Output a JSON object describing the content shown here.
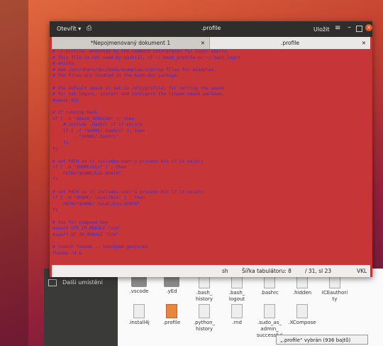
{
  "editor": {
    "open_label": "Otevřít",
    "title": ".profile",
    "save_label": "Uložit",
    "tabs": [
      {
        "label": "*Nepojmenovaný dokument 1"
      },
      {
        "label": ".profile"
      }
    ],
    "status": {
      "language": "sh",
      "tab_width": "Šířka tabulátoru: 8",
      "position": "/ 31, sl 23",
      "mode": "VKL"
    }
  },
  "code_lines": [
    "# ~/.profile: executed by the command interpreter for login shells.",
    "# This file is not read by bash(1), if ~/.bash_profile or ~/.bash_login",
    "# exists.",
    "# see /usr/share/doc/bash/examples/startup-files for examples.",
    "# the files are located in the bash-doc package.",
    "",
    "# the default umask is set in /etc/profile; for setting the umask",
    "# for ssh logins, install and configure the libpam-umask package.",
    "#umask 022",
    "",
    "# if running bash",
    "if [ -n \"$BASH_VERSION\" ]; then",
    "    # include .bashrc if it exists",
    "    if [ -f \"$HOME/.bashrc\" ]; then",
    "        . \"$HOME/.bashrc\"",
    "    fi",
    "fi",
    "",
    "# set PATH so it includes user's private bin if it exists",
    "if [ -d \"$HOME/bin\" ] ; then",
    "    PATH=\"$HOME/bin:$PATH\"",
    "fi",
    "",
    "# set PATH so it includes user's private bin if it exists",
    "if [ -d \"$HOME/.local/bin\" ] ; then",
    "    PATH=\"$HOME/.local/bin:$PATH\"",
    "fi",
    "",
    "# fix for compose key",
    "export GTK_IM_MODULE \"xim\"",
    "export QT_IM_MODULE \"xim\"",
    "",
    "# launch fusuma -- touchpad gestures",
    "fusuma -d &"
  ],
  "file_manager": {
    "sidebar_item": "Další umístění",
    "row1": [
      {
        "name": ".vscode",
        "kind": "folder"
      },
      {
        "name": ".yEd",
        "kind": "folder"
      },
      {
        "name": ".bash_\nhistory",
        "kind": "doc"
      },
      {
        "name": ".bash_\nlogout",
        "kind": "doc"
      },
      {
        "name": ".bashrc",
        "kind": "doc"
      },
      {
        "name": ".hidden",
        "kind": "doc"
      },
      {
        "name": "ICEauthori\nty",
        "kind": "doc"
      }
    ],
    "row2": [
      {
        "name": ".install4j",
        "kind": "doc"
      },
      {
        "name": ".profile",
        "kind": "doc-orange"
      },
      {
        "name": ".python_\nhistory",
        "kind": "doc"
      },
      {
        "name": ".rnd",
        "kind": "doc"
      },
      {
        "name": ".sudo_as_\nadmin_\nsuccessful",
        "kind": "doc"
      },
      {
        "name": ".XCompose",
        "kind": "doc"
      }
    ],
    "tooltip": "„.profile“ vybrán (936 bajtů)"
  }
}
